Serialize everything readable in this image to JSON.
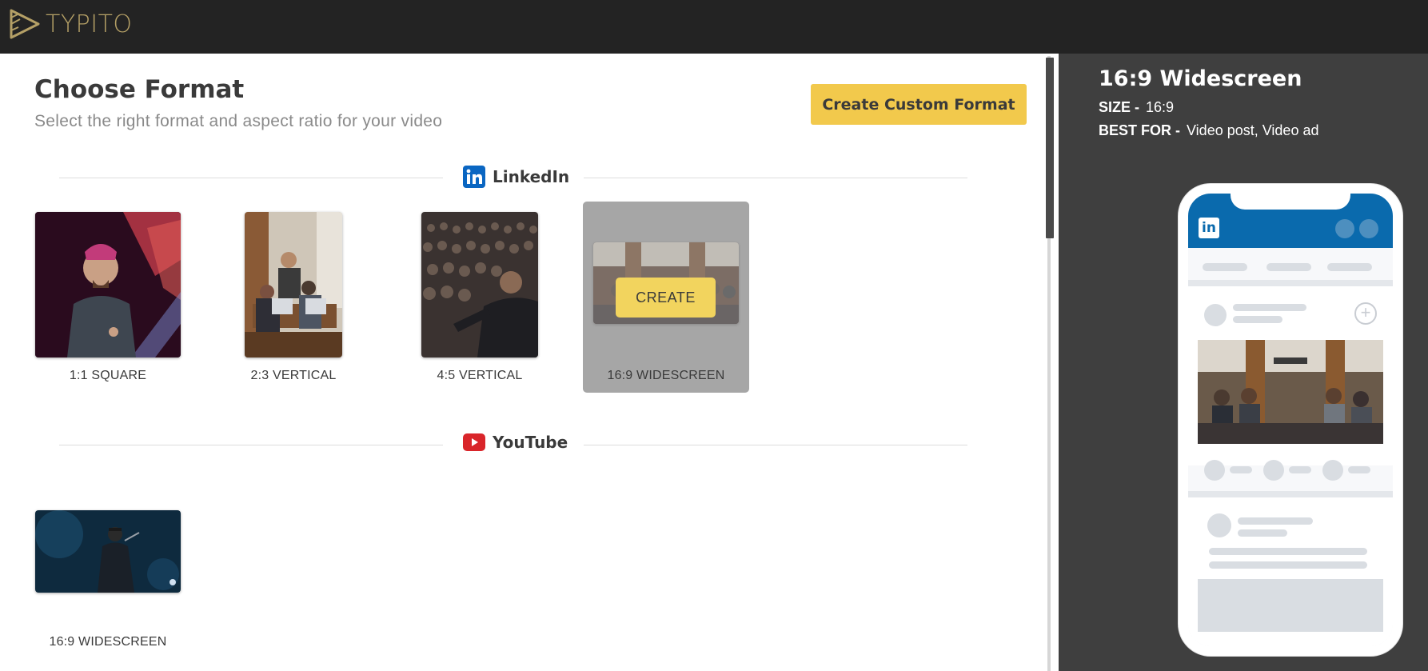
{
  "app": {
    "logo_text": "TYPITO",
    "brand_color": "#b5a066",
    "accent_color": "#f2c94c"
  },
  "header": {
    "title": "Choose Format",
    "subtitle": "Select the right format and aspect ratio for your video",
    "custom_format_label": "Create Custom Format"
  },
  "sections": [
    {
      "name": "LinkedIn",
      "icon": "linkedin-icon",
      "formats": [
        {
          "label": "1:1 SQUARE"
        },
        {
          "label": "2:3 VERTICAL"
        },
        {
          "label": "4:5 VERTICAL"
        },
        {
          "label": "16:9 WIDESCREEN",
          "selected": true,
          "action_label": "CREATE"
        }
      ]
    },
    {
      "name": "YouTube",
      "icon": "youtube-icon",
      "formats": [
        {
          "label": "16:9 WIDESCREEN"
        }
      ]
    }
  ],
  "preview": {
    "title": "16:9 Widescreen",
    "size_label": "SIZE -",
    "size_value": "16:9",
    "best_for_label": "BEST FOR -",
    "best_for_value": "Video post, Video ad",
    "device_brand_glyph": "in"
  }
}
